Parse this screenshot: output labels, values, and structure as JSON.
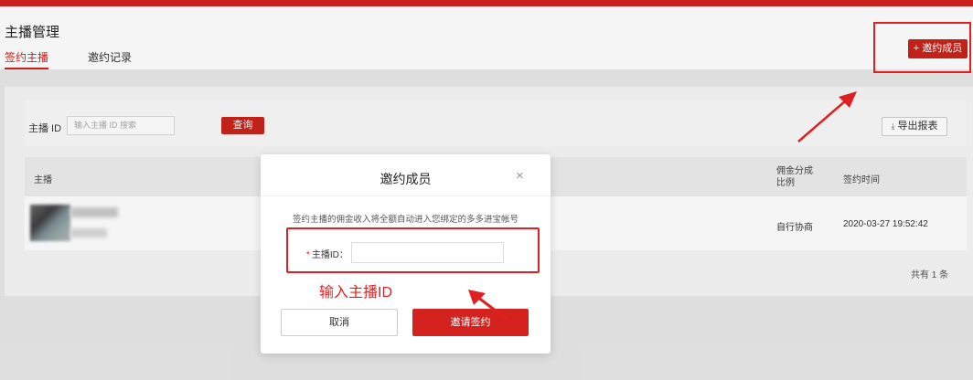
{
  "header": {
    "title": "主播管理",
    "tabs": [
      {
        "label": "签约主播",
        "active": true
      },
      {
        "label": "邀约记录",
        "active": false
      }
    ],
    "invite_button_label": "+ 邀约成员"
  },
  "filter": {
    "label": "主播 ID",
    "placeholder": "输入主播 ID 搜索",
    "search_label": "查询",
    "export_label": "导出报表"
  },
  "table": {
    "columns": [
      "主播",
      "佣金分成比例",
      "签约时间"
    ],
    "rows": [
      {
        "commission": "自行协商",
        "signed_time": "2020-03-27 19:52:42"
      }
    ],
    "total": "共有 1 条"
  },
  "modal": {
    "title": "邀约成员",
    "close_icon": "×",
    "description": "签约主播的佣金收入将全额自动进入您绑定的多多进宝帐号",
    "field_required_mark": "*",
    "field_label": "主播ID：",
    "field_value": "",
    "cancel_label": "取消",
    "confirm_label": "邀请签约"
  },
  "annotation": {
    "text": "输入主播ID",
    "color": "#e02020"
  },
  "colors": {
    "brand_red": "#d4231e",
    "button_red": "#c8241b"
  }
}
